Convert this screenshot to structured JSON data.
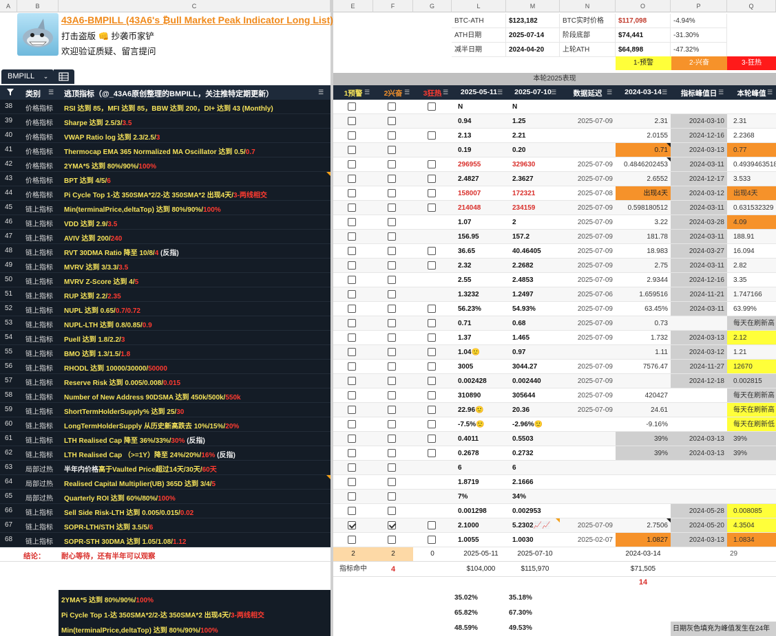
{
  "columns_left": [
    "A",
    "B",
    "C"
  ],
  "columns_right": [
    "E",
    "F",
    "G",
    "L",
    "M",
    "N",
    "O",
    "P",
    "Q"
  ],
  "header": {
    "title": "43A6-BMPILL (43A6's ₿ull Market Peak Indicator Long List)",
    "line2": "打击盗版 👊 抄袭币家铲",
    "line3": "欢迎验证质疑、留言提问"
  },
  "info": {
    "r1": {
      "l": "BTC-ATH",
      "m": "$123,182",
      "n": "BTC实时价格",
      "o": "$117,098",
      "p": "-4.94%"
    },
    "r2": {
      "l": "ATH日期",
      "m": "2025-07-14",
      "n": "阶段底部",
      "o": "$74,441",
      "p": "-31.30%"
    },
    "r3": {
      "l": "减半日期",
      "m": "2024-04-20",
      "n": "上轮ATH",
      "o": "$64,898",
      "p": "-47.32%"
    },
    "levels": [
      "1-预警",
      "2-兴奋",
      "3-狂热"
    ]
  },
  "sheet_tab": "BMPILL",
  "section_label": "本轮2025表现",
  "table_headers": {
    "category": "类别",
    "indicator": "逃顶指标（@_43A6原创整理的BMPILL，关注推特定期更新）",
    "e": "1预警",
    "f": "2兴奋",
    "g": "3狂热",
    "l": "2025-05-11",
    "m": "2025-07-10",
    "n": "数据延迟",
    "o": "2024-03-14",
    "p": "指标峰值日",
    "q": "本轮峰值"
  },
  "rows": [
    {
      "n": "38",
      "cat": "价格指标",
      "ind": [
        [
          "RSI 达到 85，MFI 达到 85，BBW 达到 200，DI+ 达到 43 (Monthly)",
          "y"
        ]
      ],
      "e": "",
      "f": "",
      "g": "",
      "l": "N",
      "m": "N",
      "nn": "",
      "o": "",
      "p": "",
      "q": ""
    },
    {
      "n": "39",
      "cat": "价格指标",
      "ind": [
        [
          "Sharpe 达到 2.5/3/",
          "y"
        ],
        [
          "3.5",
          "r"
        ]
      ],
      "e": "",
      "f": "",
      "g": "",
      "l": "0.94",
      "m": "1.25",
      "nn": "2025-07-09",
      "o": "2.31",
      "p": "2024-03-10",
      "q": "2.31"
    },
    {
      "n": "40",
      "cat": "价格指标",
      "ind": [
        [
          "VWAP Ratio log 达到 2.3/2.5/",
          "y"
        ],
        [
          "3",
          "r"
        ]
      ],
      "e": "",
      "f": "",
      "g": "",
      "l": "2.13",
      "m": "2.21",
      "nn": "",
      "o": "2.0155",
      "p": "2024-12-16",
      "q": "2.2368"
    },
    {
      "n": "41",
      "cat": "价格指标",
      "ind": [
        [
          "Thermocap EMA 365 Normalized MA Oscillator 达到 0.5/",
          "y"
        ],
        [
          "0.7",
          "r"
        ]
      ],
      "e": "",
      "f": "",
      "g": "",
      "l": "0.19",
      "m": "0.20",
      "nn": "",
      "o": "0.71",
      "p": "2024-03-13",
      "q": "0.77"
    },
    {
      "n": "42",
      "cat": "价格指标",
      "ind": [
        [
          "2YMA*5 达到 80%/90%/",
          "y"
        ],
        [
          "100%",
          "r"
        ]
      ],
      "e": "",
      "f": "",
      "g": "",
      "l": "296955",
      "m": "329630",
      "nn": "2025-07-09",
      "o": "0.4846202453",
      "p": "2024-03-11",
      "q": "0.4939463518"
    },
    {
      "n": "43",
      "cat": "价格指标",
      "ind": [
        [
          "BPT 达到 4/5/",
          "y"
        ],
        [
          "6",
          "r"
        ]
      ],
      "e": "",
      "f": "",
      "g": "",
      "l": "2.4827",
      "m": "2.3627",
      "nn": "2025-07-09",
      "o": "2.6552",
      "p": "2024-12-17",
      "q": "3.533"
    },
    {
      "n": "44",
      "cat": "价格指标",
      "ind": [
        [
          "Pi Cycle Top 1-达 350SMA*2/2-达 350SMA*2 出现4天/",
          "y"
        ],
        [
          "3-两线相交",
          "r"
        ]
      ],
      "e": "",
      "f": "",
      "g": "",
      "l": "158007",
      "m": "172321",
      "nn": "2025-07-08",
      "o": "出现4天",
      "p": "2024-03-12",
      "q": "出现4天"
    },
    {
      "n": "45",
      "cat": "链上指标",
      "ind": [
        [
          "Min(terminalPrice,deltaTop) 达到 80%/90%/",
          "y"
        ],
        [
          "100%",
          "r"
        ]
      ],
      "e": "",
      "f": "",
      "g": "",
      "l": "214048",
      "m": "234159",
      "nn": "2025-07-09",
      "o": "0.598180512",
      "p": "2024-03-11",
      "q": "0.631532329"
    },
    {
      "n": "46",
      "cat": "链上指标",
      "ind": [
        [
          "VDD 达到 2.9/",
          "y"
        ],
        [
          "3.5",
          "r"
        ]
      ],
      "e": "",
      "f": "",
      "g": "",
      "l": "1.07",
      "m": "2",
      "nn": "2025-07-09",
      "o": "3.22",
      "p": "2024-03-28",
      "q": "4.09"
    },
    {
      "n": "47",
      "cat": "链上指标",
      "ind": [
        [
          "AVIV 达到 200/",
          "y"
        ],
        [
          "240",
          "r"
        ]
      ],
      "e": "",
      "f": "",
      "g": "",
      "l": "156.95",
      "m": "157.2",
      "nn": "2025-07-09",
      "o": "181.78",
      "p": "2024-03-11",
      "q": "188.91"
    },
    {
      "n": "48",
      "cat": "链上指标",
      "ind": [
        [
          "RVT 30DMA Ratio 降至 10/8/",
          "y"
        ],
        [
          "4",
          "r"
        ],
        [
          " (反指)",
          "w"
        ]
      ],
      "e": "",
      "f": "",
      "g": "",
      "l": "36.65",
      "m": "40.46405",
      "nn": "2025-07-09",
      "o": "18.983",
      "p": "2024-03-27",
      "q": "16.094"
    },
    {
      "n": "49",
      "cat": "链上指标",
      "ind": [
        [
          "MVRV 达到 3/3.3/",
          "y"
        ],
        [
          "3.5",
          "r"
        ]
      ],
      "e": "",
      "f": "",
      "g": "",
      "l": "2.32",
      "m": "2.2682",
      "nn": "2025-07-09",
      "o": "2.75",
      "p": "2024-03-11",
      "q": "2.82"
    },
    {
      "n": "50",
      "cat": "链上指标",
      "ind": [
        [
          "MVRV Z-Score 达到 4/",
          "y"
        ],
        [
          "5",
          "r"
        ]
      ],
      "e": "",
      "f": "",
      "g": "",
      "l": "2.55",
      "m": "2.4853",
      "nn": "2025-07-09",
      "o": "2.9344",
      "p": "2024-12-16",
      "q": "3.35"
    },
    {
      "n": "51",
      "cat": "链上指标",
      "ind": [
        [
          "RUP 达到 2.2/",
          "y"
        ],
        [
          "2.35",
          "r"
        ]
      ],
      "e": "",
      "f": "",
      "g": "",
      "l": "1.3232",
      "m": "1.2497",
      "nn": "2025-07-06",
      "o": "1.659516",
      "p": "2024-11-21",
      "q": "1.747166"
    },
    {
      "n": "52",
      "cat": "链上指标",
      "ind": [
        [
          "NUPL 达到 0.65/",
          "y"
        ],
        [
          "0.7/0.72",
          "r"
        ]
      ],
      "e": "",
      "f": "",
      "g": "",
      "l": "56.23%",
      "m": "54.93%",
      "nn": "2025-07-09",
      "o": "63.45%",
      "p": "2024-03-11",
      "q": "63.99%"
    },
    {
      "n": "53",
      "cat": "链上指标",
      "ind": [
        [
          "NUPL-LTH 达到 0.8/0.85/",
          "y"
        ],
        [
          "0.9",
          "r"
        ]
      ],
      "e": "",
      "f": "",
      "g": "",
      "l": "0.71",
      "m": "0.68",
      "nn": "2025-07-09",
      "o": "0.73",
      "p": "",
      "q": "每天在刷新高"
    },
    {
      "n": "54",
      "cat": "链上指标",
      "ind": [
        [
          "Puell 达到 1.8/2.2/",
          "y"
        ],
        [
          "3",
          "r"
        ]
      ],
      "e": "",
      "f": "",
      "g": "",
      "l": "1.37",
      "m": "1.465",
      "nn": "2025-07-09",
      "o": "1.732",
      "p": "2024-03-13",
      "q": "2.12"
    },
    {
      "n": "55",
      "cat": "链上指标",
      "ind": [
        [
          "BMO 达到 1.3/1.5/",
          "y"
        ],
        [
          "1.8",
          "r"
        ]
      ],
      "e": "",
      "f": "",
      "g": "",
      "l": "1.04🙂",
      "m": "0.97",
      "nn": "",
      "o": "1.11",
      "p": "2024-03-12",
      "q": "1.21"
    },
    {
      "n": "56",
      "cat": "链上指标",
      "ind": [
        [
          "RHODL 达到 10000/30000/",
          "y"
        ],
        [
          "50000",
          "r"
        ]
      ],
      "e": "",
      "f": "",
      "g": "",
      "l": "3005",
      "m": "3044.27",
      "nn": "2025-07-09",
      "o": "7576.47",
      "p": "2024-11-27",
      "q": "12670"
    },
    {
      "n": "57",
      "cat": "链上指标",
      "ind": [
        [
          "Reserve Risk 达到 0.005/0.008/",
          "y"
        ],
        [
          "0.015",
          "r"
        ]
      ],
      "e": "",
      "f": "",
      "g": "",
      "l": "0.002428",
      "m": "0.002440",
      "nn": "2025-07-09",
      "o": "",
      "p": "2024-12-18",
      "q": "0.002815"
    },
    {
      "n": "58",
      "cat": "链上指标",
      "ind": [
        [
          "Number of New Address 90DSMA 达到 450k/500k/",
          "y"
        ],
        [
          "550k",
          "r"
        ]
      ],
      "e": "",
      "f": "",
      "g": "",
      "l": "310890",
      "m": "305644",
      "nn": "2025-07-09",
      "o": "420427",
      "p": "",
      "q": "每天在刷新高"
    },
    {
      "n": "59",
      "cat": "链上指标",
      "ind": [
        [
          "ShortTermHolderSupply% 达到 25/",
          "y"
        ],
        [
          "30",
          "r"
        ]
      ],
      "e": "",
      "f": "",
      "g": "",
      "l": "22.96🙂",
      "m": "20.36",
      "nn": "2025-07-09",
      "o": "24.61",
      "p": "",
      "q": "每天在刷新高"
    },
    {
      "n": "60",
      "cat": "链上指标",
      "ind": [
        [
          "LongTermHolderSupply 从历史新高跌去 10%/15%/",
          "y"
        ],
        [
          "20%",
          "r"
        ]
      ],
      "e": "",
      "f": "",
      "g": "",
      "l": "-7.5%🙂",
      "m": "-2.96%🙂",
      "nn": "",
      "o": "-9.16%",
      "p": "",
      "q": "每天在刷新低"
    },
    {
      "n": "61",
      "cat": "链上指标",
      "ind": [
        [
          "LTH Realised Cap 降至 36%/33%/",
          "y"
        ],
        [
          "30%",
          "r"
        ],
        [
          "  (反指)",
          "w"
        ]
      ],
      "e": "",
      "f": "",
      "g": "",
      "l": "0.4011",
      "m": "0.5503",
      "nn": "",
      "o": "39%",
      "p": "2024-03-13",
      "q": "39%"
    },
    {
      "n": "62",
      "cat": "链上指标",
      "ind": [
        [
          "LTH Realised Cap （>=1Y）降至 24%/20%/",
          "y"
        ],
        [
          "16%",
          "r"
        ],
        [
          "  (反指)",
          "w"
        ]
      ],
      "e": "",
      "f": "",
      "g": "",
      "l": "0.2678",
      "m": "0.2732",
      "nn": "",
      "o": "39%",
      "p": "2024-03-13",
      "q": "39%"
    },
    {
      "n": "63",
      "cat": "局部过热",
      "ind": [
        [
          "半年内价格",
          "w"
        ],
        [
          "高于Vaulted Price",
          "y"
        ],
        [
          "超过14天/30天/",
          "y"
        ],
        [
          "60天",
          "r"
        ]
      ],
      "e": "",
      "f": "",
      "g": "",
      "l": "6",
      "m": "6",
      "nn": "",
      "o": "",
      "p": "",
      "q": ""
    },
    {
      "n": "64",
      "cat": "局部过热",
      "ind": [
        [
          "Realised Capital Multiplier(UB)  365D 达到 3/4/",
          "y"
        ],
        [
          "5",
          "r"
        ]
      ],
      "e": "",
      "f": "",
      "g": "",
      "l": "1.8719",
      "m": "2.1666",
      "nn": "",
      "o": "",
      "p": "",
      "q": ""
    },
    {
      "n": "65",
      "cat": "局部过热",
      "ind": [
        [
          "Quarterly ROI 达到 60%/80%/",
          "y"
        ],
        [
          "100%",
          "r"
        ]
      ],
      "e": "",
      "f": "",
      "g": "",
      "l": "7%",
      "m": "34%",
      "nn": "",
      "o": "",
      "p": "",
      "q": ""
    },
    {
      "n": "66",
      "cat": "链上指标",
      "ind": [
        [
          "Sell Side Risk-LTH 达到 0.005/0.015/",
          "y"
        ],
        [
          "0.02",
          "r"
        ]
      ],
      "e": "",
      "f": "",
      "g": "",
      "l": "0.001298",
      "m": "0.002953",
      "nn": "",
      "o": "",
      "p": "2024-05-28",
      "q": "0.008085"
    },
    {
      "n": "67",
      "cat": "链上指标",
      "ind": [
        [
          "SOPR-LTH/STH 达到 3.5/5/",
          "y"
        ],
        [
          "6",
          "r"
        ]
      ],
      "e": "",
      "f": "",
      "g": "",
      "l": "2.1000",
      "m": "5.2302📈📈",
      "nn": "2025-07-09",
      "o": "2.7506",
      "p": "2024-05-20",
      "q": "4.3504"
    },
    {
      "n": "68",
      "cat": "链上指标",
      "ind": [
        [
          "SOPR-STH 30DMA 达到 1.05/1.08/",
          "y"
        ],
        [
          "1.12",
          "r"
        ]
      ],
      "e": "",
      "f": "",
      "g": "",
      "l": "1.0055",
      "m": "1.0030",
      "nn": "2025-02-07",
      "o": "1.0827",
      "p": "2024-03-13",
      "q": "1.0834"
    }
  ],
  "conclusion": {
    "label": "结论：",
    "text": "耐心等待，还有半年可以观察",
    "e": "2",
    "f": "2",
    "g": "0",
    "l": "2025-05-11",
    "m": "2025-07-10",
    "o": "2024-03-14",
    "q": "29"
  },
  "hits": {
    "label": "指标命中",
    "count": "4",
    "l": "$104,000",
    "m": "$115,970",
    "o": "$71,505",
    "o2": "14"
  },
  "bottom": [
    {
      "ind": [
        [
          "2YMA*5 达到 80%/90%/",
          "y"
        ],
        [
          "100%",
          "r"
        ]
      ],
      "l": "35.02%",
      "m": "35.18%"
    },
    {
      "ind": [
        [
          "Pi Cycle Top  1-达 350SMA*2/2-达 350SMA*2 出现4天/",
          "y"
        ],
        [
          "3-两线相交",
          "r"
        ]
      ],
      "l": "65.82%",
      "m": "67.30%"
    },
    {
      "ind": [
        [
          "Min(terminalPrice,deltaTop) 达到 80%/90%/",
          "y"
        ],
        [
          "100%",
          "r"
        ]
      ],
      "l": "48.59%",
      "m": "49.53%"
    }
  ],
  "note": "日期灰色填充为峰值发生在24年",
  "colors": {
    "dark_bg": "#141c26",
    "yellow": "#f5e25a",
    "red_text": "#ff3b30",
    "orange": "#f6922a",
    "grey": "#cfcfcf",
    "bright_yellow": "#ffff3a",
    "header_bg": "#1e2a3a"
  }
}
